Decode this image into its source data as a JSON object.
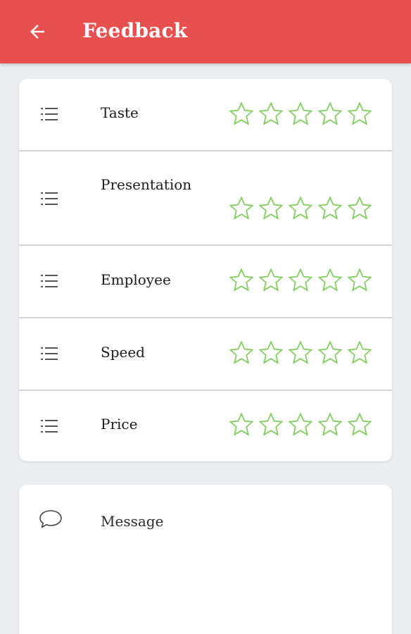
{
  "appbar": {
    "title": "Feedback",
    "back_icon": "arrow-left-icon",
    "background": "#e84f4f"
  },
  "ratings": {
    "star_color": "#7fcc5d",
    "max_stars": 5,
    "items": [
      {
        "label": "Taste",
        "icon": "list-icon",
        "rating": 0
      },
      {
        "label": "Presentation",
        "icon": "list-icon",
        "rating": 0
      },
      {
        "label": "Employee",
        "icon": "list-icon",
        "rating": 0
      },
      {
        "label": "Speed",
        "icon": "list-icon",
        "rating": 0
      },
      {
        "label": "Price",
        "icon": "list-icon",
        "rating": 0
      }
    ]
  },
  "message": {
    "label": "Message",
    "icon": "chat-bubble-icon"
  }
}
